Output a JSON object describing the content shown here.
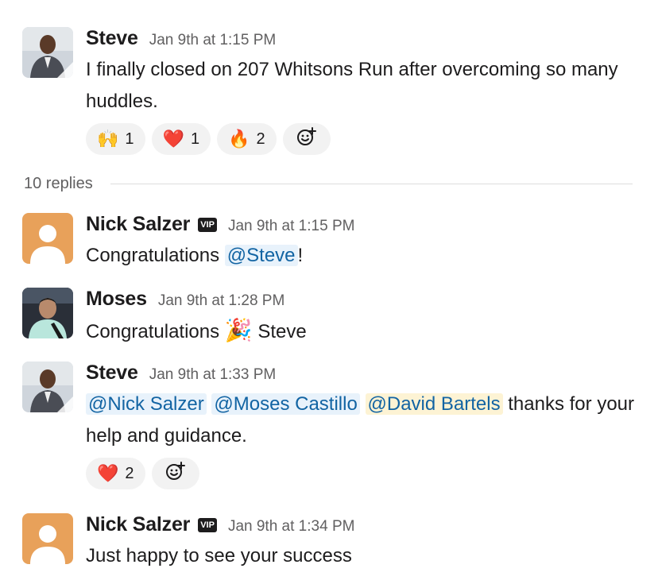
{
  "messages": [
    {
      "name": "Steve",
      "time": "Jan 9th at 1:15 PM",
      "text": "I finally closed on 207 Whitsons Run after overcoming so many huddles.",
      "reactions": [
        {
          "emoji": "🙌",
          "count": "1"
        },
        {
          "emoji": "❤️",
          "count": "1"
        },
        {
          "emoji": "🔥",
          "count": "2"
        }
      ]
    },
    {
      "name": "Nick Salzer",
      "badge": "VIP",
      "time": "Jan 9th at 1:15 PM",
      "text_before": "Congratulations ",
      "mention": "@Steve",
      "text_after": "!"
    },
    {
      "name": "Moses",
      "time": "Jan 9th at 1:28 PM",
      "text_before": "Congratulations ",
      "emoji": "🎉",
      "text_after": " Steve"
    },
    {
      "name": "Steve",
      "time": "Jan 9th at 1:33 PM",
      "mentions": [
        "@Nick Salzer",
        "@Moses Castillo",
        "@David Bartels"
      ],
      "text_after": " thanks for your help and guidance.",
      "reactions": [
        {
          "emoji": "❤️",
          "count": "2"
        }
      ]
    },
    {
      "name": "Nick Salzer",
      "badge": "VIP",
      "time": "Jan 9th at 1:34 PM",
      "text": "Just happy to see your success"
    }
  ],
  "thread": {
    "replies_label": "10 replies"
  },
  "colors": {
    "mention_bg": "#e8f2fb",
    "mention_self_bg": "#fdf3d4",
    "mention_text": "#1264a3",
    "reaction_bg": "#f2f2f2",
    "default_avatar_bg": "#e8a15a"
  },
  "icons": {
    "add_reaction": "add-reaction-icon"
  }
}
